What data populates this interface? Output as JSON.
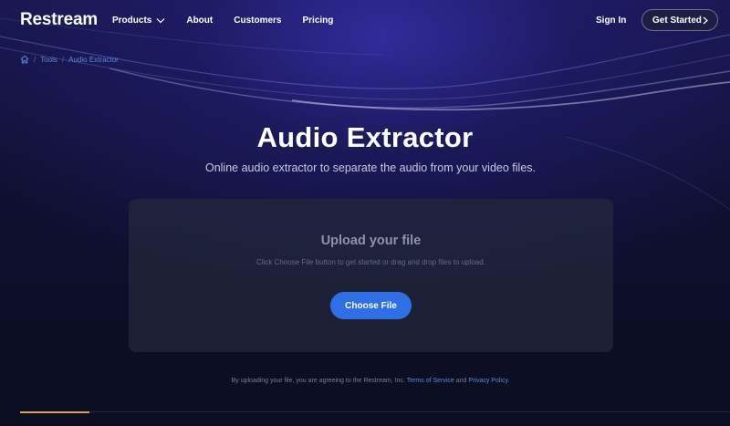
{
  "header": {
    "logo": "Restream",
    "menu": [
      "Products",
      "About",
      "Customers",
      "Pricing"
    ],
    "sign_in": "Sign In",
    "cta": "Get Started"
  },
  "breadcrumb": {
    "items": [
      "Tools",
      "Audio Extractor"
    ],
    "separator": "/"
  },
  "hero": {
    "title": "Audio Extractor",
    "subtitle": "Online audio extractor to separate the audio from your video files."
  },
  "upload": {
    "title": "Upload your file",
    "hint": "Click Choose File button to get started or drag and drop files to upload.",
    "button": "Choose File"
  },
  "terms": {
    "prefix": "By uploading your file, you are agreeing to the Restream, Inc.",
    "tos": "Terms of Service",
    "and": "and",
    "privacy": "Privacy Policy",
    "suffix": "."
  },
  "colors": {
    "accent_blue": "#2f6fe6",
    "link_blue": "#5a8bd8",
    "progress": "#e0a238"
  }
}
